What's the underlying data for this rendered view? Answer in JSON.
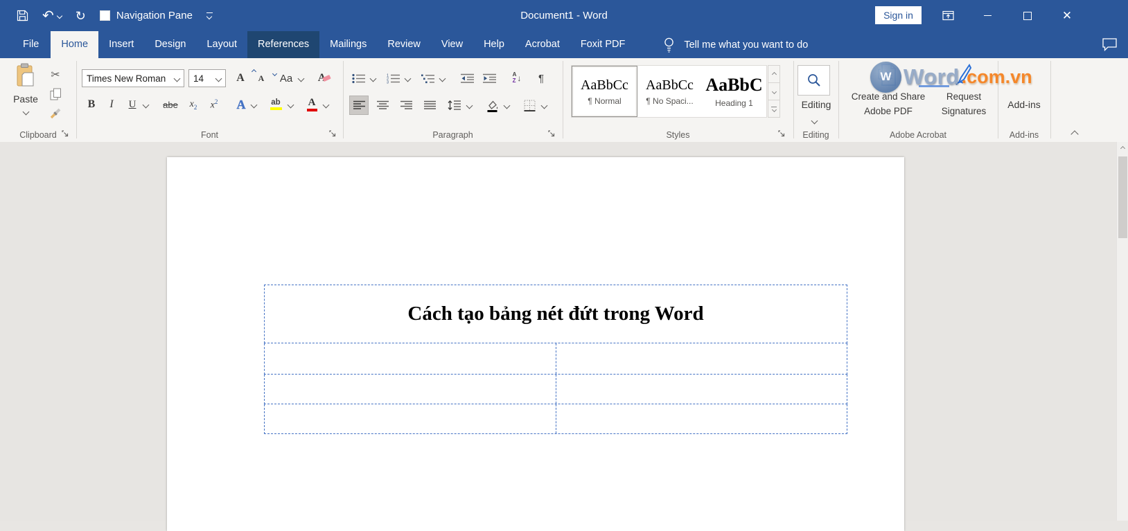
{
  "titlebar": {
    "title": "Document1 - Word",
    "sign_in_label": "Sign in",
    "navigation_pane_label": "Navigation Pane"
  },
  "tabs": [
    {
      "label": "File"
    },
    {
      "label": "Home",
      "selected": true
    },
    {
      "label": "Insert"
    },
    {
      "label": "Design"
    },
    {
      "label": "Layout"
    },
    {
      "label": "References",
      "highlighted": true
    },
    {
      "label": "Mailings"
    },
    {
      "label": "Review"
    },
    {
      "label": "View"
    },
    {
      "label": "Help"
    },
    {
      "label": "Acrobat"
    },
    {
      "label": "Foxit PDF"
    }
  ],
  "tell_me": {
    "label": "Tell me what you want to do"
  },
  "ribbon": {
    "clipboard": {
      "group_label": "Clipboard",
      "paste_label": "Paste"
    },
    "font": {
      "group_label": "Font",
      "font_name": "Times New Roman",
      "font_size": "14",
      "grow_label": "A",
      "shrink_label": "A",
      "case_label": "Aa",
      "clear_label": "A",
      "bold_label": "B",
      "italic_label": "I",
      "underline_label": "U",
      "strikethrough_label": "abe",
      "sub_base": "x",
      "sub_script": "2",
      "sup_base": "x",
      "sup_script": "2",
      "effects_label": "A",
      "highlight_label": "ab",
      "font_color_label": "A"
    },
    "paragraph": {
      "group_label": "Paragraph",
      "sort_a": "A",
      "sort_z": "Z",
      "pilcrow": "¶"
    },
    "styles": {
      "group_label": "Styles",
      "items": [
        {
          "preview": "AaBbCc",
          "name": "¶ Normal",
          "selected": true
        },
        {
          "preview": "AaBbCc",
          "name": "¶ No Spaci..."
        },
        {
          "preview": "AaBbC",
          "name": "Heading 1"
        }
      ]
    },
    "editing": {
      "group_label": "Editing",
      "button_label": "Editing"
    },
    "acrobat": {
      "group_label": "Adobe Acrobat",
      "create_line1": "Create and Share",
      "create_line2": "Adobe PDF",
      "request_line1": "Request",
      "request_line2": "Signatures"
    },
    "addins": {
      "group_label": "Add-ins",
      "button_label": "Add-ins"
    }
  },
  "watermark": {
    "icon_letter": "W",
    "text_word": "Word",
    "text_domain": ".com.vn"
  },
  "document": {
    "table": {
      "title": "Cách tạo bảng nét đứt trong Word",
      "border_style": "dashed",
      "border_color": "#4472c4",
      "columns": 2,
      "body_rows": 3
    }
  },
  "colors": {
    "titlebar_blue": "#2b579a",
    "tab_highlight_blue": "#1f4671",
    "table_border_blue": "#4472c4",
    "watermark_orange": "#f58220",
    "highlight_yellow": "#ffff00",
    "font_color_red": "#e00000"
  }
}
